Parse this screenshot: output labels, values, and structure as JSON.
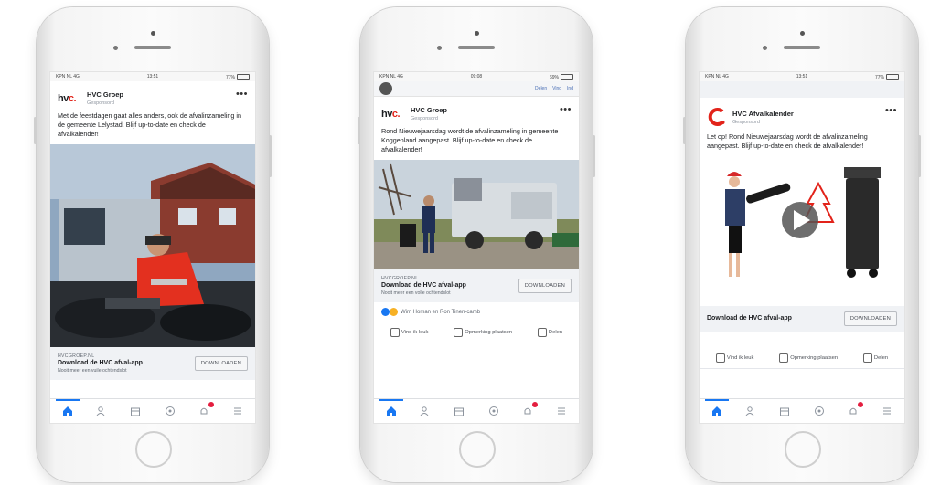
{
  "phones": [
    {
      "status": {
        "carrier": "KPN NL 4G",
        "time": "13:51",
        "battery": "77%"
      },
      "post": {
        "page_name": "HVC Groep",
        "sponsored": "Gesponsord",
        "text": "Met de feestdagen gaat alles anders, ook de afvalinzameling in de gemeente Lelystad. Blijf up-to-date en check de afvalkalender!"
      },
      "cta": {
        "domain": "HVCGROEP.NL",
        "title": "Download de HVC afval-app",
        "desc": "Nooit meer een vuile ochtendslot",
        "button": "DOWNLOADEN"
      }
    },
    {
      "status": {
        "carrier": "KPN NL 4G",
        "time": "09:08",
        "battery": "69%"
      },
      "prev": {
        "links": [
          "Delen",
          "Vind",
          "Ind"
        ]
      },
      "post": {
        "page_name": "HVC Groep",
        "sponsored": "Gesponsord",
        "text": "Rond Nieuwejaarsdag wordt de afvalinzameling in gemeente Koggenland aangepast. Blijf up-to-date en check de afvalkalender!"
      },
      "cta": {
        "domain": "HVCGROEP.NL",
        "title": "Download de HVC afval-app",
        "desc": "Nooit meer een volle ochtendslot",
        "button": "DOWNLOADEN"
      },
      "reactions": "Wim Homan en Ron Tinen-camb",
      "actions": {
        "like": "Vind ik leuk",
        "comment": "Opmerking plaatsen",
        "share": "Delen"
      }
    },
    {
      "status": {
        "carrier": "KPN NL 4G",
        "time": "13:51",
        "battery": "77%"
      },
      "post": {
        "page_name": "HVC Afvalkalender",
        "sponsored": "Gesponsord",
        "text": "Let op! Rond Nieuwejaarsdag wordt de afvalinzameling aangepast. Blijf up-to-date en check de afvalkalender!"
      },
      "cta": {
        "title": "Download de HVC afval-app",
        "button": "DOWNLOADEN"
      },
      "actions": {
        "like": "Vind ik leuk",
        "comment": "Opmerking plaatsen",
        "share": "Delen"
      }
    }
  ],
  "logo": {
    "text_main": "hv",
    "text_accent": "c."
  },
  "icons": [
    "home-icon",
    "friends-icon",
    "marketplace-icon",
    "groups-icon",
    "notifications-icon",
    "menu-icon"
  ],
  "colors": {
    "accent": "#1877f2",
    "brand_red": "#e2231a",
    "cta_bg": "#f0f2f5"
  }
}
